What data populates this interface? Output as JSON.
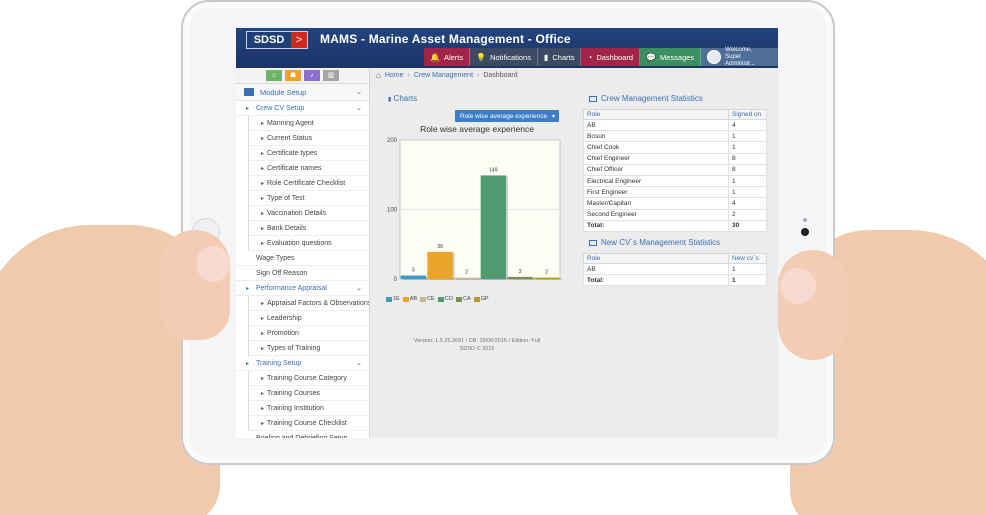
{
  "app": {
    "logo_text": "SDSD",
    "logo_arrow": ">",
    "title": "MAMS - Marine Asset Management - Office"
  },
  "nav": {
    "alerts": "Alerts",
    "notifications": "Notifications",
    "charts": "Charts",
    "dashboard": "Dashboard",
    "messages": "Messages",
    "welcome": "Welcome,",
    "user": "Super Administr..."
  },
  "sidebar": {
    "module": "Module Setup",
    "items": [
      {
        "label": "Crew CV Setup",
        "kind": "group"
      },
      {
        "label": "Manning Agent",
        "kind": "sub"
      },
      {
        "label": "Current Status",
        "kind": "sub"
      },
      {
        "label": "Certificate types",
        "kind": "sub"
      },
      {
        "label": "Certificate names",
        "kind": "sub"
      },
      {
        "label": "Role Certificate Checklist",
        "kind": "sub"
      },
      {
        "label": "Type of Test",
        "kind": "sub"
      },
      {
        "label": "Vaccination Details",
        "kind": "sub"
      },
      {
        "label": "Bank Details",
        "kind": "sub"
      },
      {
        "label": "Evaluation questions",
        "kind": "sub"
      },
      {
        "label": "Wage Types",
        "kind": "plain"
      },
      {
        "label": "Sign Off Reason",
        "kind": "plain"
      },
      {
        "label": "Performance Appraisal",
        "kind": "group"
      },
      {
        "label": "Appraisal Factors & Observations",
        "kind": "sub"
      },
      {
        "label": "Leadership",
        "kind": "sub"
      },
      {
        "label": "Promotion",
        "kind": "sub"
      },
      {
        "label": "Types of Training",
        "kind": "sub"
      },
      {
        "label": "Training Setup",
        "kind": "group"
      },
      {
        "label": "Training Course Category",
        "kind": "sub"
      },
      {
        "label": "Training Courses",
        "kind": "sub"
      },
      {
        "label": "Training Institution",
        "kind": "sub"
      },
      {
        "label": "Training Course Checklist",
        "kind": "sub"
      },
      {
        "label": "Briefing and Debriefing Setup",
        "kind": "plain"
      }
    ]
  },
  "breadcrumb": {
    "home": "Home",
    "crew": "Crew Management",
    "current": "Dashboard"
  },
  "charts_section": {
    "heading": "Charts",
    "dropdown_label": "Role wise average experience"
  },
  "chart_data": {
    "type": "bar",
    "title": "Role wise average experience",
    "categories": [
      "1E",
      "AB",
      "CE",
      "CO",
      "CA",
      "GP"
    ],
    "values": [
      5,
      39,
      2,
      149,
      3,
      2
    ],
    "colors": [
      "#3a9bc8",
      "#e9a528",
      "#c9b98d",
      "#4f9a6e",
      "#7a8d52",
      "#b39a2c"
    ],
    "yticks": [
      0,
      100,
      200
    ],
    "ylim": [
      0,
      200
    ],
    "legend_position": "bottom-left"
  },
  "version": {
    "line1": "Version: 1.5.25.3691 / DB: 19/06/2015 / Edition: Full",
    "line2": "SDSD © 2015"
  },
  "crew_stats": {
    "heading": "Crew Management Statistics",
    "headers": [
      "Role",
      "Signed on"
    ],
    "rows": [
      [
        "AB",
        "4"
      ],
      [
        "Bosun",
        "1"
      ],
      [
        "Chief Cook",
        "1"
      ],
      [
        "Chief Engineer",
        "8"
      ],
      [
        "Chief Officer",
        "8"
      ],
      [
        "Electrical Engineer",
        "1"
      ],
      [
        "First Engineer",
        "1"
      ],
      [
        "Master/Capitan",
        "4"
      ],
      [
        "Second Engineer",
        "2"
      ]
    ],
    "total_label": "Total:",
    "total_value": "30"
  },
  "cv_stats": {
    "heading": "New CV`s Management Statistics",
    "headers": [
      "Role",
      "New cv`s"
    ],
    "rows": [
      [
        "AB",
        "1"
      ]
    ],
    "total_label": "Total:",
    "total_value": "1"
  }
}
